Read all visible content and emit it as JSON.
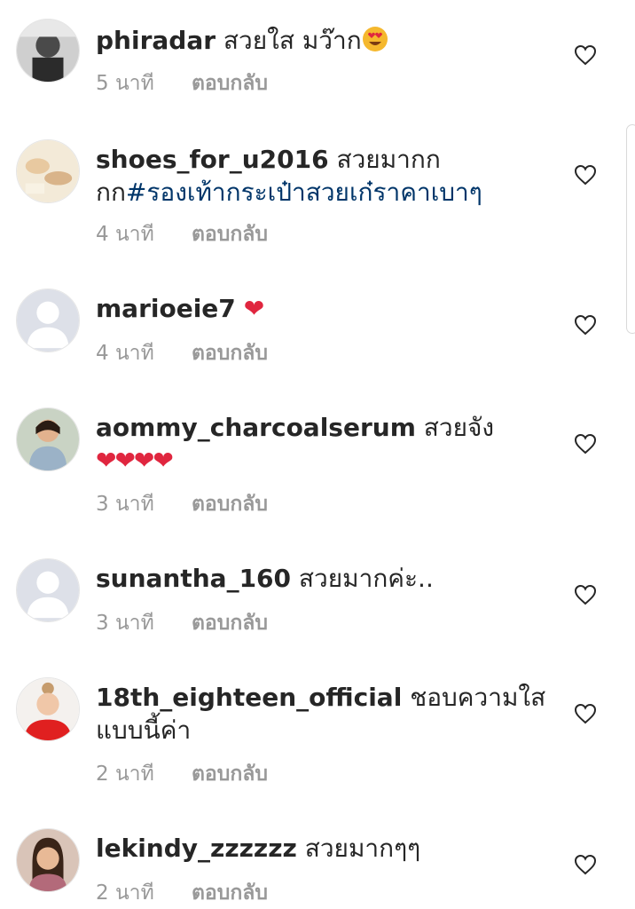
{
  "comments": [
    {
      "username": "phiradar",
      "text": " สวยใส มว๊าก",
      "time": "5 นาที",
      "reply": "ตอบกลับ",
      "emoji": "heart-eyes-emoji",
      "avatar": "photo"
    },
    {
      "username": "shoes_for_u2016",
      "text": " สวยมากกกก",
      "hashtag": "#รองเท้ากระเป๋าสวยเก๋ราคาเบาๆ",
      "time": "4 นาที",
      "reply": "ตอบกลับ",
      "avatar": "photo"
    },
    {
      "username": "marioeie7",
      "text": " ",
      "hearts": "❤",
      "time": "4 นาที",
      "reply": "ตอบกลับ",
      "avatar": "default"
    },
    {
      "username": "aommy_charcoalserum",
      "text": " สวยจัง",
      "hearts": "❤❤❤❤",
      "time": "3 นาที",
      "reply": "ตอบกลับ",
      "avatar": "photo"
    },
    {
      "username": "sunantha_160",
      "text": " สวยมากค่ะ..",
      "time": "3 นาที",
      "reply": "ตอบกลับ",
      "avatar": "default"
    },
    {
      "username": "18th_eighteen_official",
      "text": " ชอบความใสแบบนี้ค่า",
      "time": "2 นาที",
      "reply": "ตอบกลับ",
      "avatar": "photo"
    },
    {
      "username": "lekindy_zzzzzz",
      "text": " สวยมากๆๆ",
      "time": "2 นาที",
      "reply": "ตอบกลับ",
      "avatar": "photo"
    }
  ],
  "colors": {
    "username": "#262626",
    "hashtag": "#003569",
    "meta": "#999999",
    "heart": "#e0263f"
  },
  "icons": {
    "like": "heart-outline-icon"
  }
}
